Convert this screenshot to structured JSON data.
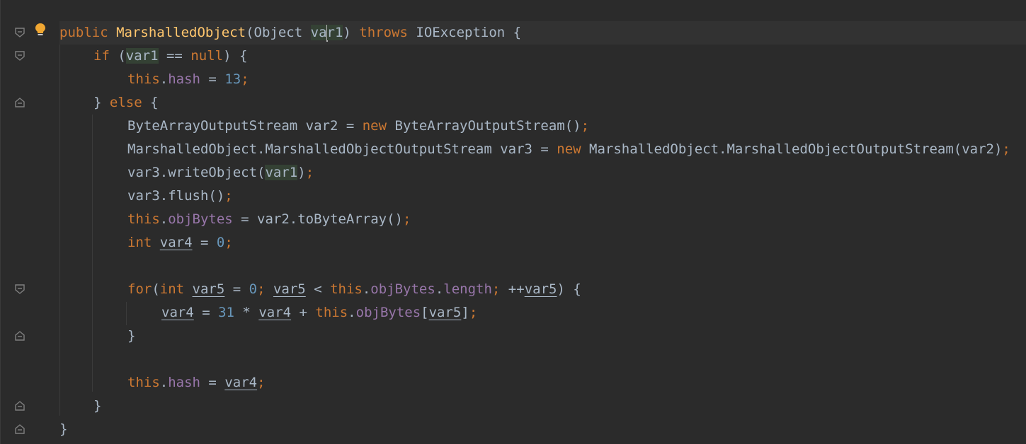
{
  "editor": {
    "language": "Java",
    "theme_colors": {
      "background": "#2b2b2b",
      "keyword": "#cc7832",
      "method": "#ffc66d",
      "field": "#9876aa",
      "number": "#6897bb",
      "text": "#a9b7c6",
      "usage_highlight": "#344134"
    },
    "gutter_icons": [
      "intention-bulb-icon",
      "fold-marker-icon"
    ],
    "lines": [
      {
        "indent": 0,
        "tokens": [
          [
            "kw",
            "public "
          ],
          [
            "fn",
            "MarshalledObject"
          ],
          [
            "t",
            "(Object "
          ],
          [
            "hl",
            "va"
          ],
          [
            "caret",
            ""
          ],
          [
            "hl",
            "r1"
          ],
          [
            "t",
            ") "
          ],
          [
            "kw",
            "throws "
          ],
          [
            "t",
            "IOException {"
          ]
        ]
      },
      {
        "indent": 1,
        "tokens": [
          [
            "kw",
            "if "
          ],
          [
            "t",
            "("
          ],
          [
            "hl",
            "var1"
          ],
          [
            "t",
            " == "
          ],
          [
            "kw",
            "null"
          ],
          [
            "t",
            ") {"
          ]
        ]
      },
      {
        "indent": 2,
        "tokens": [
          [
            "kw",
            "this"
          ],
          [
            "t",
            "."
          ],
          [
            "fld",
            "hash"
          ],
          [
            "t",
            " = "
          ],
          [
            "num",
            "13"
          ],
          [
            "kw",
            ";"
          ]
        ]
      },
      {
        "indent": 1,
        "tokens": [
          [
            "t",
            "} "
          ],
          [
            "kw",
            "else "
          ],
          [
            "t",
            "{"
          ]
        ]
      },
      {
        "indent": 2,
        "tokens": [
          [
            "t",
            "ByteArrayOutputStream var2 = "
          ],
          [
            "kw",
            "new "
          ],
          [
            "t",
            "ByteArrayOutputStream()"
          ],
          [
            "kw",
            ";"
          ]
        ]
      },
      {
        "indent": 2,
        "tokens": [
          [
            "t",
            "MarshalledObject.MarshalledObjectOutputStream var3 = "
          ],
          [
            "kw",
            "new "
          ],
          [
            "t",
            "MarshalledObject.MarshalledObjectOutputStream(var2)"
          ],
          [
            "kw",
            ";"
          ]
        ]
      },
      {
        "indent": 2,
        "tokens": [
          [
            "t",
            "var3.writeObject("
          ],
          [
            "hl",
            "var1"
          ],
          [
            "t",
            ")"
          ],
          [
            "kw",
            ";"
          ]
        ]
      },
      {
        "indent": 2,
        "tokens": [
          [
            "t",
            "var3.flush()"
          ],
          [
            "kw",
            ";"
          ]
        ]
      },
      {
        "indent": 2,
        "tokens": [
          [
            "kw",
            "this"
          ],
          [
            "t",
            "."
          ],
          [
            "fld",
            "objBytes"
          ],
          [
            "t",
            " = var2.toByteArray()"
          ],
          [
            "kw",
            ";"
          ]
        ]
      },
      {
        "indent": 2,
        "tokens": [
          [
            "kw",
            "int "
          ],
          [
            "ul",
            "var4"
          ],
          [
            "t",
            " = "
          ],
          [
            "num",
            "0"
          ],
          [
            "kw",
            ";"
          ]
        ]
      },
      {
        "indent": 2,
        "tokens": []
      },
      {
        "indent": 2,
        "tokens": [
          [
            "kw",
            "for"
          ],
          [
            "t",
            "("
          ],
          [
            "kw",
            "int "
          ],
          [
            "ul",
            "var5"
          ],
          [
            "t",
            " = "
          ],
          [
            "num",
            "0"
          ],
          [
            "kw",
            "; "
          ],
          [
            "ul",
            "var5"
          ],
          [
            "t",
            " < "
          ],
          [
            "kw",
            "this"
          ],
          [
            "t",
            "."
          ],
          [
            "fld",
            "objBytes"
          ],
          [
            "t",
            "."
          ],
          [
            "fld",
            "length"
          ],
          [
            "kw",
            "; "
          ],
          [
            "t",
            "++"
          ],
          [
            "ul",
            "var5"
          ],
          [
            "t",
            ") {"
          ]
        ]
      },
      {
        "indent": 3,
        "tokens": [
          [
            "ul",
            "var4"
          ],
          [
            "t",
            " = "
          ],
          [
            "num",
            "31"
          ],
          [
            "t",
            " * "
          ],
          [
            "ul",
            "var4"
          ],
          [
            "t",
            " + "
          ],
          [
            "kw",
            "this"
          ],
          [
            "t",
            "."
          ],
          [
            "fld",
            "objBytes"
          ],
          [
            "t",
            "["
          ],
          [
            "ul",
            "var5"
          ],
          [
            "t",
            "]"
          ],
          [
            "kw",
            ";"
          ]
        ]
      },
      {
        "indent": 2,
        "tokens": [
          [
            "t",
            "}"
          ]
        ]
      },
      {
        "indent": 2,
        "tokens": []
      },
      {
        "indent": 2,
        "tokens": [
          [
            "kw",
            "this"
          ],
          [
            "t",
            "."
          ],
          [
            "fld",
            "hash"
          ],
          [
            "t",
            " = "
          ],
          [
            "ul",
            "var4"
          ],
          [
            "kw",
            ";"
          ]
        ]
      },
      {
        "indent": 1,
        "tokens": [
          [
            "t",
            "}"
          ]
        ]
      },
      {
        "indent": 0,
        "tokens": [
          [
            "t",
            "}"
          ]
        ]
      }
    ]
  }
}
